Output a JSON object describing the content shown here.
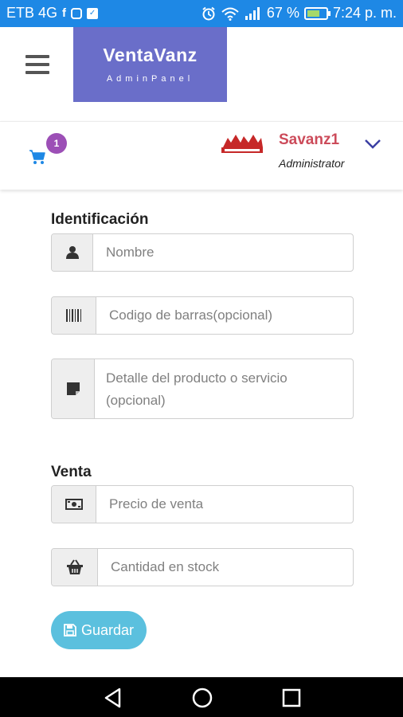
{
  "status_bar": {
    "carrier": "ETB 4G",
    "battery_percent_label": "67 %",
    "battery_level": 0.67,
    "time": "7:24 p. m.",
    "bg_color": "#1e88e5"
  },
  "header": {
    "brand_title": "VentaVanz",
    "brand_subtitle": "AdminPanel",
    "brand_color": "#6a6ec9",
    "menu_icon": "hamburger-icon"
  },
  "user_bar": {
    "cart_icon": "cart-icon",
    "cart_count": "1",
    "user_name": "Savanz1",
    "user_role": "Administrator",
    "user_name_color": "#cc4b5a",
    "badge_color": "#9c4fb6"
  },
  "form": {
    "identification": {
      "title": "Identificación",
      "name_placeholder": "Nombre",
      "barcode_placeholder": "Codigo de barras(opcional)",
      "detail_placeholder": "Detalle del producto o servicio (opcional)"
    },
    "sale": {
      "title": "Venta",
      "price_placeholder": "Precio de venta",
      "stock_placeholder": "Cantidad en stock"
    },
    "save_label": "Guardar",
    "save_color": "#5bc0de"
  },
  "nav": {
    "back_icon": "back-icon",
    "home_icon": "home-icon",
    "recents_icon": "recents-icon"
  }
}
